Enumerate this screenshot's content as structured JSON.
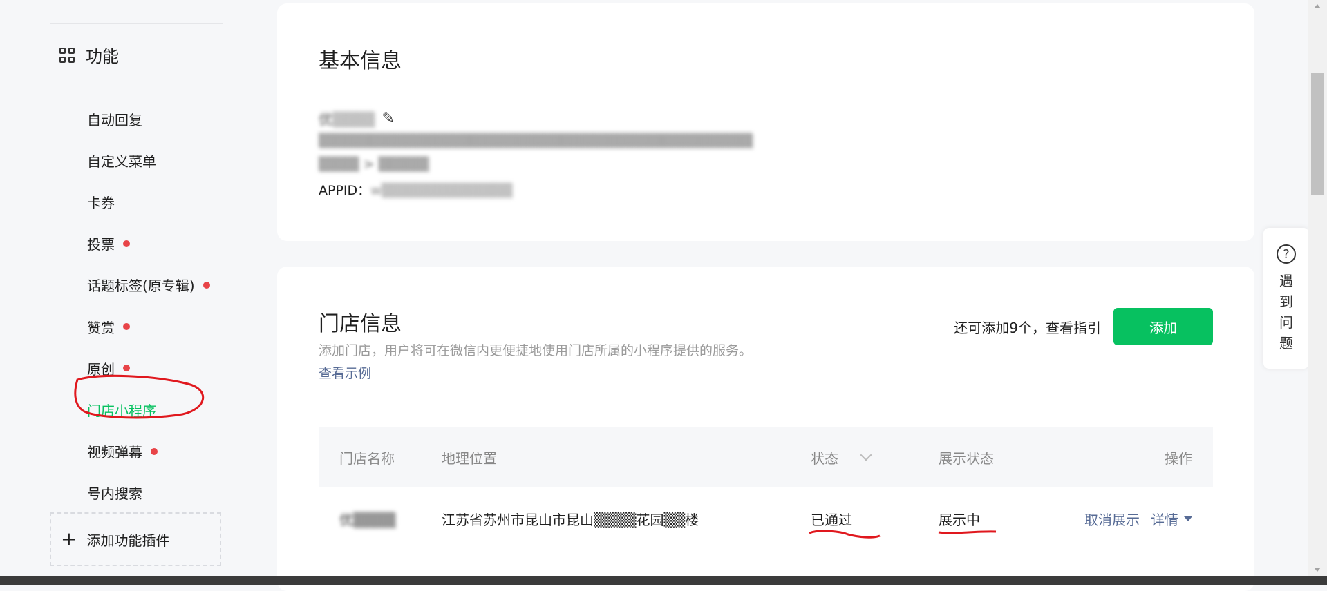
{
  "sidebar": {
    "section_title": "功能",
    "section_icon": "grid-icon",
    "items": [
      {
        "label": "自动回复",
        "dot": false
      },
      {
        "label": "自定义菜单",
        "dot": false
      },
      {
        "label": "卡券",
        "dot": false
      },
      {
        "label": "投票",
        "dot": true
      },
      {
        "label": "话题标签(原专辑)",
        "dot": true
      },
      {
        "label": "赞赏",
        "dot": true
      },
      {
        "label": "原创",
        "dot": true
      },
      {
        "label": "门店小程序",
        "dot": false,
        "active": true
      },
      {
        "label": "视频弹幕",
        "dot": true
      },
      {
        "label": "号内搜索",
        "dot": false
      }
    ],
    "add_plugin": "添加功能插件"
  },
  "basic_info": {
    "title": "基本信息",
    "name_blurred": "优▒▒▒▒",
    "line1_blurred": "▒▒▒▒▒▒▒▒▒▒▒▒▒▒▒▒▒▒▒▒▒▒▒▒▒▒▒▒▒▒▒▒▒▒▒▒▒▒▒▒▒▒▒",
    "line2_blurred": "▒▒▒▒ > ▒▒▒▒▒",
    "appid_label": "APPID：",
    "appid_blurred": "w▒▒▒▒▒▒▒▒▒▒▒▒▒"
  },
  "store_info": {
    "title": "门店信息",
    "description": "添加门店，用户将可在微信内更便捷地使用门店所属的小程序提供的服务。",
    "example_link": "查看示例",
    "remaining_text": "还可添加9个，",
    "guide_link": "查看指引",
    "add_button": "添加",
    "table": {
      "headers": {
        "name": "门店名称",
        "location": "地理位置",
        "status": "状态",
        "display_status": "展示状态",
        "action": "操作"
      },
      "rows": [
        {
          "name": "优▒▒▒▒",
          "location": "江苏省苏州市昆山市昆山▒▒▒▒花园▒▒楼",
          "status": "已通过",
          "display_status": "展示中",
          "cancel_action": "取消展示",
          "detail_action": "详情"
        }
      ]
    }
  },
  "help": {
    "icon": "question-icon",
    "label": "遇到问题"
  },
  "colors": {
    "accent": "#07c160",
    "link": "#576b95",
    "dot": "#e84448",
    "annotation": "#e0181e"
  }
}
